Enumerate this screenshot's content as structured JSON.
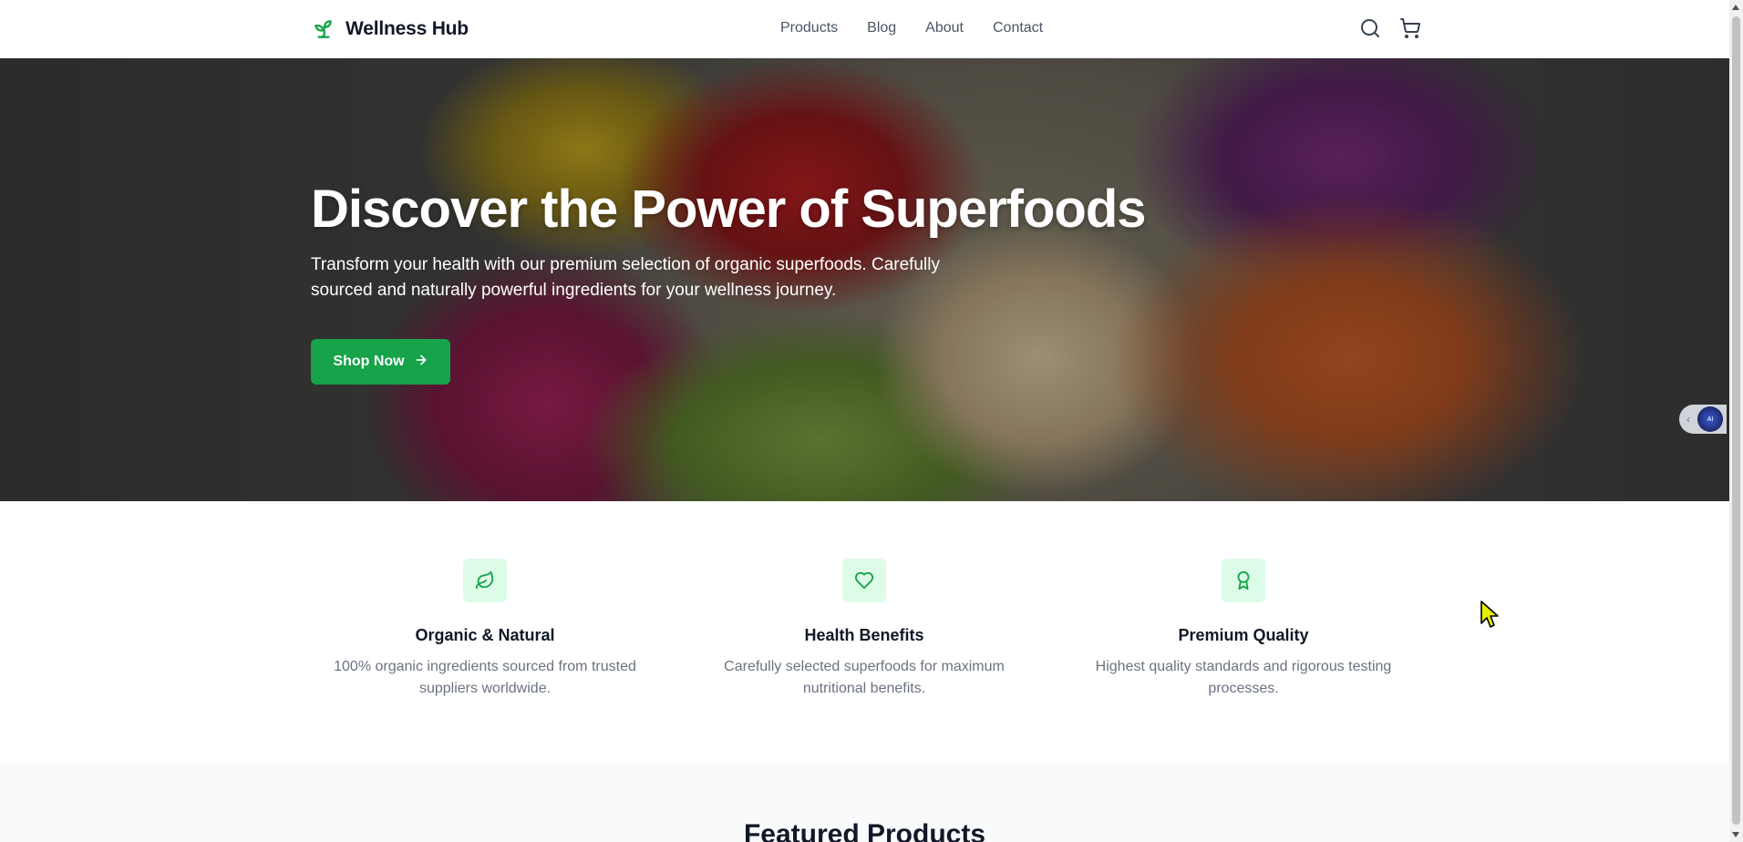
{
  "header": {
    "logo_text": "Wellness Hub",
    "nav": [
      "Products",
      "Blog",
      "About",
      "Contact"
    ]
  },
  "hero": {
    "title": "Discover the Power of Superfoods",
    "subtitle": "Transform your health with our premium selection of organic superfoods. Carefully sourced and naturally powerful ingredients for your wellness journey.",
    "cta_label": "Shop Now",
    "widget_label": "AI"
  },
  "features": [
    {
      "icon": "leaf-icon",
      "title": "Organic & Natural",
      "text": "100% organic ingredients sourced from trusted suppliers worldwide."
    },
    {
      "icon": "heart-icon",
      "title": "Health Benefits",
      "text": "Carefully selected superfoods for maximum nutritional benefits."
    },
    {
      "icon": "award-icon",
      "title": "Premium Quality",
      "text": "Highest quality standards and rigorous testing processes."
    }
  ],
  "featured": {
    "title": "Featured Products"
  },
  "colors": {
    "accent": "#16a34a",
    "accent_light": "#dcfce7",
    "text_dark": "#111827",
    "text_muted": "#6b7280"
  }
}
